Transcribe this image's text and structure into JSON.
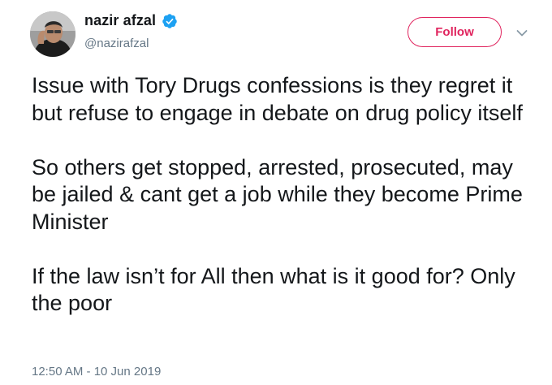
{
  "author": {
    "display_name": "nazir afzal",
    "handle": "@nazirafzal",
    "verified": true,
    "avatar_icon": "profile-photo"
  },
  "follow_button": {
    "label": "Follow",
    "color": "#e0245e"
  },
  "menu_icon": "chevron-down-icon",
  "tweet": {
    "paragraphs": [
      "Issue with Tory Drugs confessions is they regret it but refuse to engage in debate on drug policy itself",
      "So others get stopped, arrested, prosecuted, may be jailed & cant get a job while they become Prime Minister",
      "If the law isn’t for All then what is it good for? Only the poor"
    ],
    "timestamp": "12:50 AM - 10 Jun 2019"
  },
  "colors": {
    "text": "#14171a",
    "secondary_text": "#657786",
    "verified_badge": "#1da1f2"
  }
}
